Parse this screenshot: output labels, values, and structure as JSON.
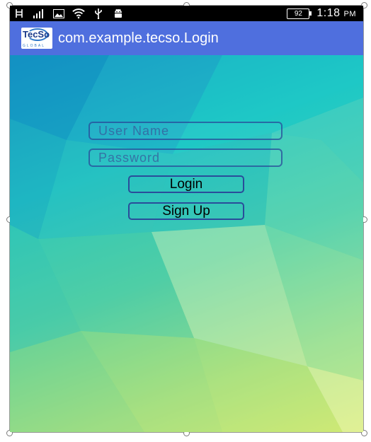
{
  "status_bar": {
    "icons": [
      "usb-debug-icon",
      "signal-bars-icon",
      "image-icon",
      "wifi-icon",
      "usb-icon",
      "android-icon"
    ],
    "battery_level": "92",
    "time": "1:18",
    "meridiem": "PM"
  },
  "action_bar": {
    "logo_text": "TecSo",
    "logo_subtext": "GLOBAL",
    "title": "com.example.tecso.Login"
  },
  "login_form": {
    "username_placeholder": "User Name",
    "password_placeholder": "Password",
    "login_label": "Login",
    "signup_label": "Sign Up"
  },
  "colors": {
    "action_bar": "#4f6fde",
    "field_border": "#2a4c9a",
    "status_bar": "#000000"
  }
}
